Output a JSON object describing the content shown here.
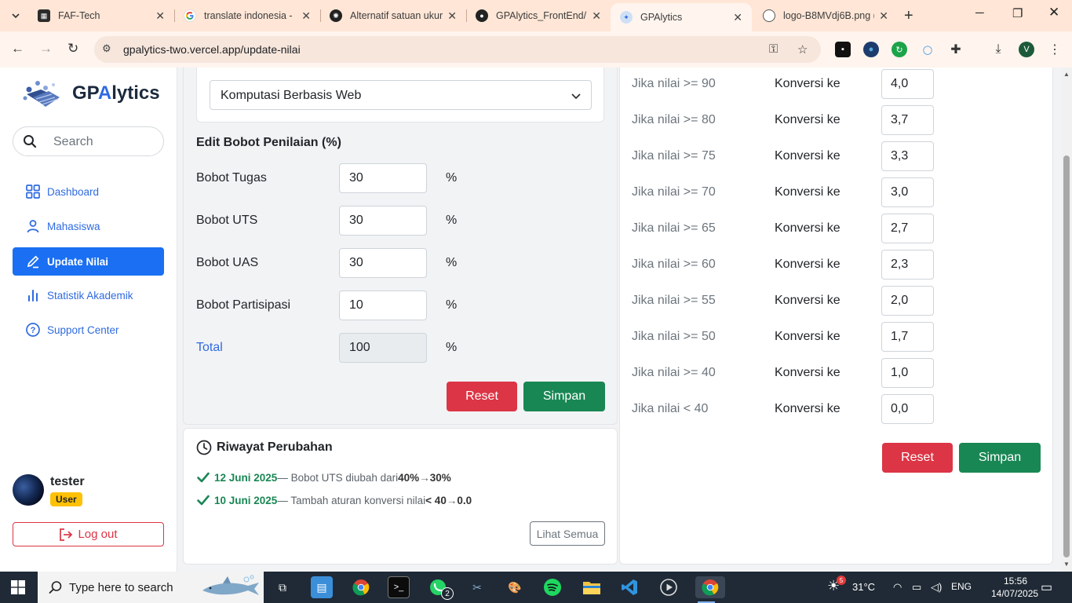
{
  "browser": {
    "tabs": [
      {
        "title": "FAF-Tech",
        "icon": "faf-tech-favicon"
      },
      {
        "title": "translate indonesia - ",
        "icon": "google-favicon"
      },
      {
        "title": "Alternatif satuan ukur",
        "icon": "chatgpt-favicon"
      },
      {
        "title": "GPAlytics_FrontEnd/P",
        "icon": "github-favicon"
      },
      {
        "title": "GPAlytics",
        "icon": "gpalytics-favicon"
      },
      {
        "title": "logo-B8MVdj6B.png (",
        "icon": "globe-favicon"
      }
    ],
    "url": "gpalytics-two.vercel.app/update-nilai",
    "profile_initial": "V"
  },
  "sidebar": {
    "brand_prefix": "GP",
    "brand_highlight": "A",
    "brand_suffix": "lytics",
    "search_placeholder": "Search",
    "items": [
      {
        "label": "Dashboard",
        "icon": "grid-icon"
      },
      {
        "label": "Mahasiswa",
        "icon": "person-icon"
      },
      {
        "label": "Update Nilai",
        "icon": "pencil-icon"
      },
      {
        "label": "Statistik Akademik",
        "icon": "bar-chart-icon"
      },
      {
        "label": "Support Center",
        "icon": "help-circle-icon"
      }
    ],
    "user": {
      "name": "tester",
      "role": "User"
    },
    "logout_label": "Log out"
  },
  "course_select": {
    "value": "Komputasi Berbasis Web"
  },
  "weights": {
    "title": "Edit Bobot Penilaian (%)",
    "rows": [
      {
        "label": "Bobot Tugas",
        "value": "30",
        "unit": "%"
      },
      {
        "label": "Bobot UTS",
        "value": "30",
        "unit": "%"
      },
      {
        "label": "Bobot UAS",
        "value": "30",
        "unit": "%"
      },
      {
        "label": "Bobot Partisipasi",
        "value": "10",
        "unit": "%"
      },
      {
        "label": "Total",
        "value": "100",
        "unit": "%"
      }
    ],
    "reset_label": "Reset",
    "save_label": "Simpan"
  },
  "history": {
    "title": "Riwayat Perubahan",
    "items": [
      {
        "date": "12 Juni 2025",
        "text": " — Bobot UTS diubah dari ",
        "from": "40%",
        "arrow": " → ",
        "to": "30%"
      },
      {
        "date": "10 Juni 2025",
        "text": " — Tambah aturan konversi nilai ",
        "from": "< 40",
        "arrow": " → ",
        "to": "0.0"
      }
    ],
    "see_all_label": "Lihat Semua"
  },
  "conversion": {
    "rows": [
      {
        "condition": "Jika nilai >= 90",
        "mid": "Konversi ke",
        "value": "4,0"
      },
      {
        "condition": "Jika nilai >= 80",
        "mid": "Konversi ke",
        "value": "3,7"
      },
      {
        "condition": "Jika nilai >= 75",
        "mid": "Konversi ke",
        "value": "3,3"
      },
      {
        "condition": "Jika nilai >= 70",
        "mid": "Konversi ke",
        "value": "3,0"
      },
      {
        "condition": "Jika nilai >= 65",
        "mid": "Konversi ke",
        "value": "2,7"
      },
      {
        "condition": "Jika nilai >= 60",
        "mid": "Konversi ke",
        "value": "2,3"
      },
      {
        "condition": "Jika nilai >= 55",
        "mid": "Konversi ke",
        "value": "2,0"
      },
      {
        "condition": "Jika nilai >= 50",
        "mid": "Konversi ke",
        "value": "1,7"
      },
      {
        "condition": "Jika nilai >= 40",
        "mid": "Konversi ke",
        "value": "1,0"
      },
      {
        "condition": "Jika nilai < 40",
        "mid": "Konversi ke",
        "value": "0,0"
      }
    ],
    "reset_label": "Reset",
    "save_label": "Simpan"
  },
  "taskbar": {
    "search_placeholder": "Type here to search",
    "whatsapp_badge": "2",
    "weather_badge": "5",
    "temperature": "31°C",
    "language": "ENG",
    "time": "15:56",
    "date": "14/07/2025"
  },
  "colors": {
    "primary": "#1a6ff2",
    "danger": "#dc3545",
    "success": "#198754",
    "warning": "#ffc107",
    "chrome_tabstrip": "#ffe6d6"
  }
}
